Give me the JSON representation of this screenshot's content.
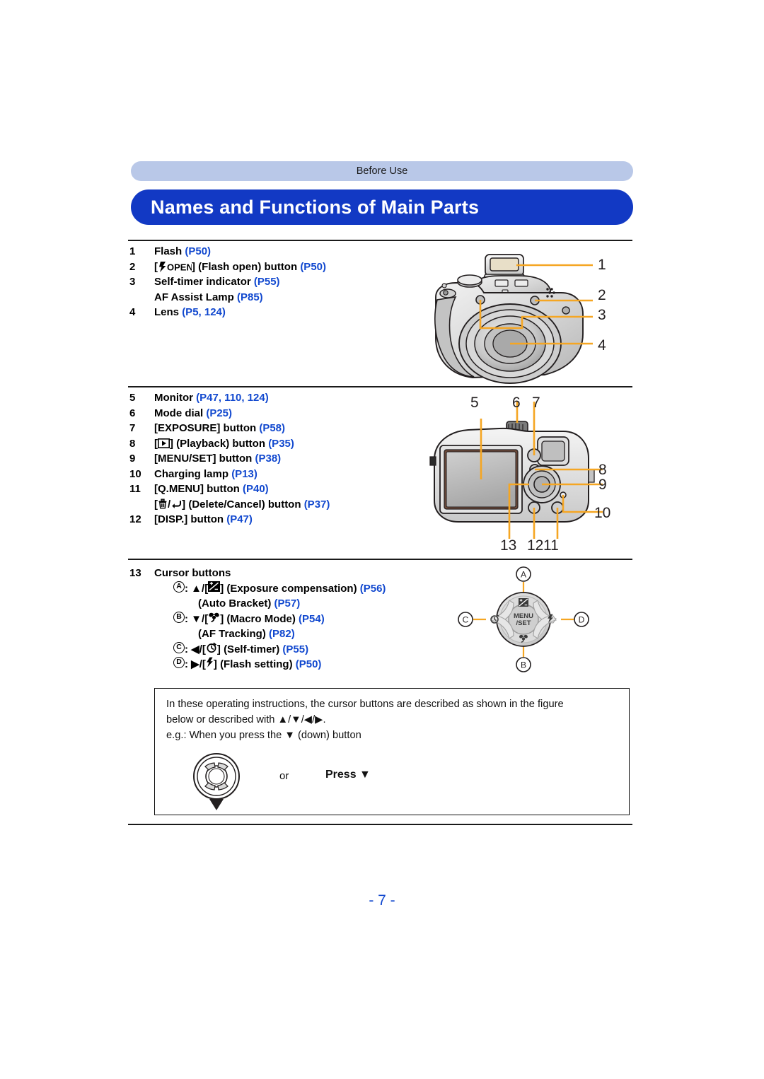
{
  "header": {
    "section_label": "Before Use",
    "title": "Names and Functions of Main Parts",
    "accent_color": "#1239c4",
    "section_bar_color": "#b9c8e8",
    "link_color": "#1148cf",
    "callout_line_color": "#f5a623"
  },
  "parts_block_1": [
    {
      "num": "1",
      "label": "Flash",
      "ref": "(P50)"
    },
    {
      "num": "2",
      "label": "[⚡OPEN] (Flash open) button",
      "ref": "(P50)",
      "icon": "flash-open-icon"
    },
    {
      "num": "3",
      "label": "Self-timer indicator",
      "ref": "(P55)"
    },
    {
      "num": "",
      "label": "AF Assist Lamp",
      "ref": "(P85)"
    },
    {
      "num": "4",
      "label": "Lens",
      "ref": "(P5, 124)"
    }
  ],
  "parts_block_2": [
    {
      "num": "5",
      "label": "Monitor",
      "ref": "(P47, 110, 124)"
    },
    {
      "num": "6",
      "label": "Mode dial",
      "ref": "(P25)"
    },
    {
      "num": "7",
      "label": "[EXPOSURE] button",
      "ref": "(P58)"
    },
    {
      "num": "8",
      "label": "[▶] (Playback) button",
      "ref": "(P35)",
      "icon": "playback-icon"
    },
    {
      "num": "9",
      "label": "[MENU/SET] button",
      "ref": "(P38)"
    },
    {
      "num": "10",
      "label": "Charging lamp",
      "ref": "(P13)"
    },
    {
      "num": "11",
      "label": "[Q.MENU] button",
      "ref": "(P40)"
    },
    {
      "num": "",
      "label": "[🗑/↩] (Delete/Cancel) button",
      "ref": "(P37)",
      "icon": "delete-cancel-icon"
    },
    {
      "num": "12",
      "label": "[DISP.] button",
      "ref": "(P47)"
    }
  ],
  "parts_block_3": {
    "num": "13",
    "label": "Cursor buttons",
    "rows": [
      {
        "letter": "A",
        "arrow": "▲",
        "icon": "exposure-compensation-icon",
        "label": "(Exposure compensation)",
        "ref": "(P56)"
      },
      {
        "letter": "",
        "arrow": "",
        "icon": "",
        "label": "(Auto Bracket)",
        "ref": "(P57)"
      },
      {
        "letter": "B",
        "arrow": "▼",
        "icon": "macro-icon",
        "label": "(Macro Mode)",
        "ref": "(P54)"
      },
      {
        "letter": "",
        "arrow": "",
        "icon": "",
        "label": "(AF Tracking)",
        "ref": "(P82)"
      },
      {
        "letter": "C",
        "arrow": "◀",
        "icon": "self-timer-icon",
        "label": "(Self-timer)",
        "ref": "(P55)"
      },
      {
        "letter": "D",
        "arrow": "▶",
        "icon": "flash-icon",
        "label": "(Flash setting)",
        "ref": "(P50)"
      }
    ]
  },
  "front_view_callouts": [
    "1",
    "2",
    "3",
    "4"
  ],
  "rear_view_callouts": [
    "5",
    "6",
    "7",
    "8",
    "9",
    "10",
    "13",
    "12",
    "11"
  ],
  "cursor_diagram": {
    "center_label_top": "MENU",
    "center_label_bottom": "/SET",
    "labels": [
      "A",
      "B",
      "C",
      "D"
    ]
  },
  "note": {
    "line1": "In these operating instructions, the cursor buttons are described as shown in the figure",
    "line2": "below or described with ▲/▼/◀/▶.",
    "line3": "e.g.: When you press the ▼ (down) button",
    "or_label": "or",
    "press_label": "Press ▼"
  },
  "footer": {
    "page_number": "- 7 -"
  }
}
